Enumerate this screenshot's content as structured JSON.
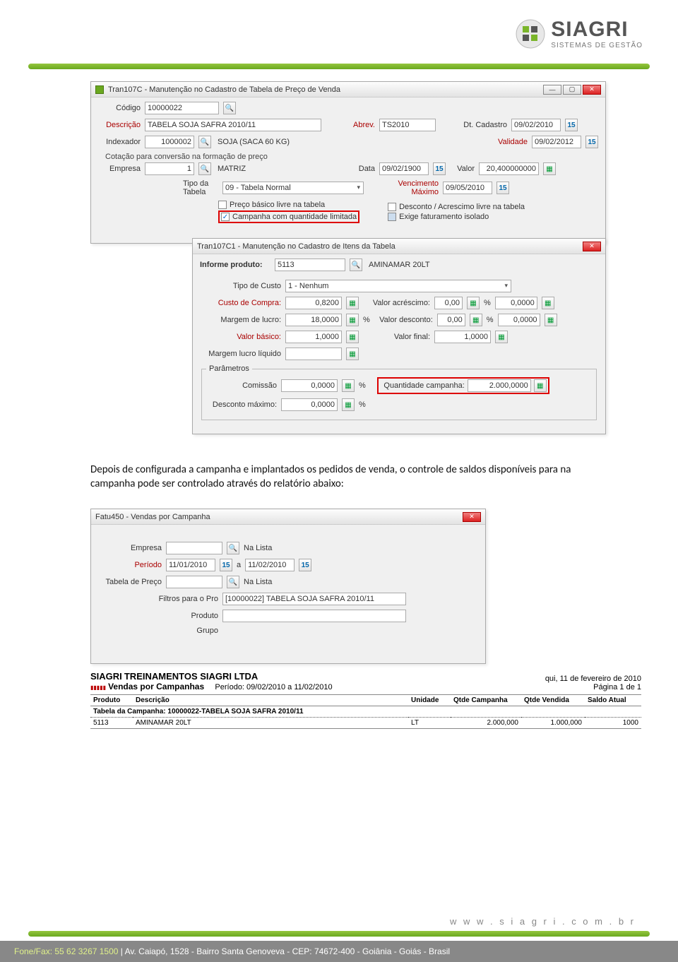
{
  "logo": {
    "name": "SIAGRI",
    "tagline": "SISTEMAS DE GESTÃO"
  },
  "win1": {
    "title": "Tran107C - Manutenção no Cadastro de Tabela de Preço de Venda",
    "codigo_lbl": "Código",
    "codigo": "10000022",
    "descricao_lbl": "Descrição",
    "descricao": "TABELA SOJA SAFRA 2010/11",
    "abrev_lbl": "Abrev.",
    "abrev": "TS2010",
    "dtcad_lbl": "Dt. Cadastro",
    "dtcad": "09/02/2010",
    "indexador_lbl": "Indexador",
    "indexador_cod": "1000002",
    "indexador_desc": "SOJA (SACA 60 KG)",
    "validade_lbl": "Validade",
    "validade": "09/02/2012",
    "cotacao_grp": "Cotação para conversão na formação de preço",
    "empresa_lbl": "Empresa",
    "empresa_cod": "1",
    "empresa_desc": "MATRIZ",
    "data_lbl": "Data",
    "data": "09/02/1900",
    "valor_lbl": "Valor",
    "valor": "20,400000000",
    "tipo_tabela_lbl": "Tipo da Tabela",
    "tipo_tabela": "09 - Tabela Normal",
    "venc_max_lbl": "Vencimento Máximo",
    "venc_max": "09/05/2010",
    "chk1": "Preço básico livre na tabela",
    "chk2": "Campanha com quantidade limitada",
    "chk3": "Desconto / Acrescimo livre na tabela",
    "chk4": "Exige faturamento isolado"
  },
  "win2": {
    "title": "Tran107C1 - Manutenção no Cadastro de Itens da Tabela",
    "informe_lbl": "Informe produto:",
    "informe_cod": "5113",
    "informe_desc": "AMINAMAR 20LT",
    "tipocusto_lbl": "Tipo de Custo",
    "tipocusto": "1 - Nenhum",
    "custocompra_lbl": "Custo de Compra:",
    "custocompra": "0,8200",
    "margemlucro_lbl": "Margem de lucro:",
    "margemlucro": "18,0000",
    "valorbasico_lbl": "Valor básico:",
    "valorbasico": "1,0000",
    "margemliq_lbl": "Margem lucro líquido",
    "valoracresc_lbl": "Valor acréscimo:",
    "valoracresc": "0,00",
    "valoracresc2": "0,0000",
    "valordesc_lbl": "Valor desconto:",
    "valordesc": "0,00",
    "valordesc2": "0,0000",
    "valorfinal_lbl": "Valor final:",
    "valorfinal": "1,0000",
    "pct": "%",
    "params_lbl": "Parâmetros",
    "comissao_lbl": "Comissão",
    "comissao": "0,0000",
    "qtdcamp_lbl": "Quantidade campanha:",
    "qtdcamp": "2.000,0000",
    "descmax_lbl": "Desconto máximo:",
    "descmax": "0,0000"
  },
  "bodytext": "Depois de configurada a campanha e implantados os pedidos de venda, o controle de saldos disponíveis para na campanha pode ser controlado através do relatório abaixo:",
  "win3": {
    "title": "Fatu450 - Vendas por Campanha",
    "empresa_lbl": "Empresa",
    "nalista": "Na Lista",
    "periodo_lbl": "Período",
    "periodo1": "11/01/2010",
    "a": "a",
    "periodo2": "11/02/2010",
    "tabela_lbl": "Tabela de Preço",
    "filtros_lbl": "Filtros para o Pro",
    "filtros_val": "[10000022] TABELA SOJA SAFRA 2010/11",
    "produto_lbl": "Produto",
    "grupo_lbl": "Grupo"
  },
  "report": {
    "company": "TREINAMENTOS SIAGRI LTDA",
    "brand": "SIAGRI",
    "title": "Vendas por Campanhas",
    "periodo": "Período: 09/02/2010 a 11/02/2010",
    "date": "qui, 11 de fevereiro de 2010",
    "page": "Página 1 de 1",
    "cols": [
      "Produto",
      "Descrição",
      "Unidade",
      "Qtde Campanha",
      "Qtde Vendida",
      "Saldo Atual"
    ],
    "group": "Tabela da Campanha: 10000022-TABELA SOJA SAFRA 2010/11",
    "row": {
      "prod": "5113",
      "desc": "AMINAMAR 20LT",
      "un": "LT",
      "qcamp": "2.000,000",
      "qvend": "1.000,000",
      "saldo": "1000"
    }
  },
  "footer": {
    "url": "w w w . s i a g r i . c o m . b r",
    "line1": "Fone/Fax: 55 62 3267 1500",
    "line2": "| Av. Caiapó, 1528 - Bairro Santa Genoveva - CEP: 74672-400 - Goiânia - Goiás - Brasil"
  }
}
